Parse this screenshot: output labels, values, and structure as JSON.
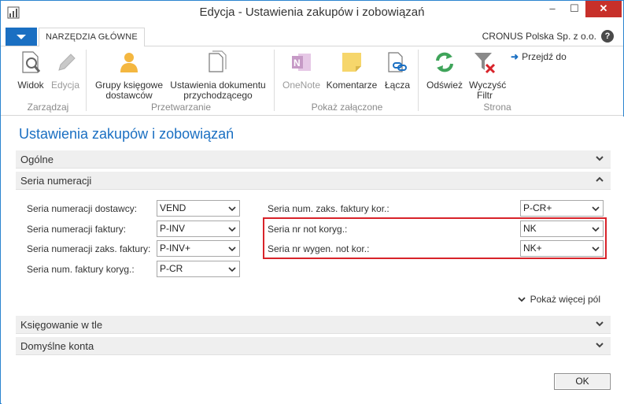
{
  "window": {
    "title": "Edycja - Ustawienia zakupów i zobowiązań",
    "minimize": "–",
    "maximize": "☐",
    "close": "✕"
  },
  "ribbon": {
    "tab": "NARZĘDZIA GŁÓWNE",
    "company": "CRONUS Polska Sp. z o.o.",
    "help": "?",
    "buttons": {
      "view": "Widok",
      "edit": "Edycja",
      "vendor_posting_groups": "Grupy księgowe dostawców",
      "incoming_doc_setup": "Ustawienia dokumentu przychodzącego",
      "onenote": "OneNote",
      "comments": "Komentarze",
      "links": "Łącza",
      "refresh": "Odśwież",
      "clear_filter": "Wyczyść Filtr",
      "goto": "Przejdź do"
    },
    "groups": {
      "manage": "Zarządzaj",
      "process": "Przetwarzanie",
      "attachments": "Pokaż załączone",
      "page": "Strona"
    }
  },
  "page": {
    "title": "Ustawienia zakupów i zobowiązań",
    "fasttabs": {
      "general": "Ogólne",
      "numbering": "Seria numeracji",
      "background_posting": "Księgowanie w tle",
      "default_accounts": "Domyślne konta"
    },
    "left_fields": [
      {
        "label": "Seria numeracji dostawcy:",
        "value": "VEND"
      },
      {
        "label": "Seria numeracji faktury:",
        "value": "P-INV"
      },
      {
        "label": "Seria numeracji zaks. faktury:",
        "value": "P-INV+"
      },
      {
        "label": "Seria num. faktury koryg.:",
        "value": "P-CR"
      }
    ],
    "right_fields": [
      {
        "label": "Seria num. zaks. faktury kor.:",
        "value": "P-CR+"
      },
      {
        "label": "Seria nr not koryg.:",
        "value": "NK"
      },
      {
        "label": "Seria nr wygen. not kor.:",
        "value": "NK+"
      }
    ],
    "show_more": "Pokaż więcej pól",
    "ok": "OK"
  },
  "colors": {
    "accent": "#1a6fc2",
    "highlight": "#d8232a",
    "close_button": "#c7302a"
  }
}
